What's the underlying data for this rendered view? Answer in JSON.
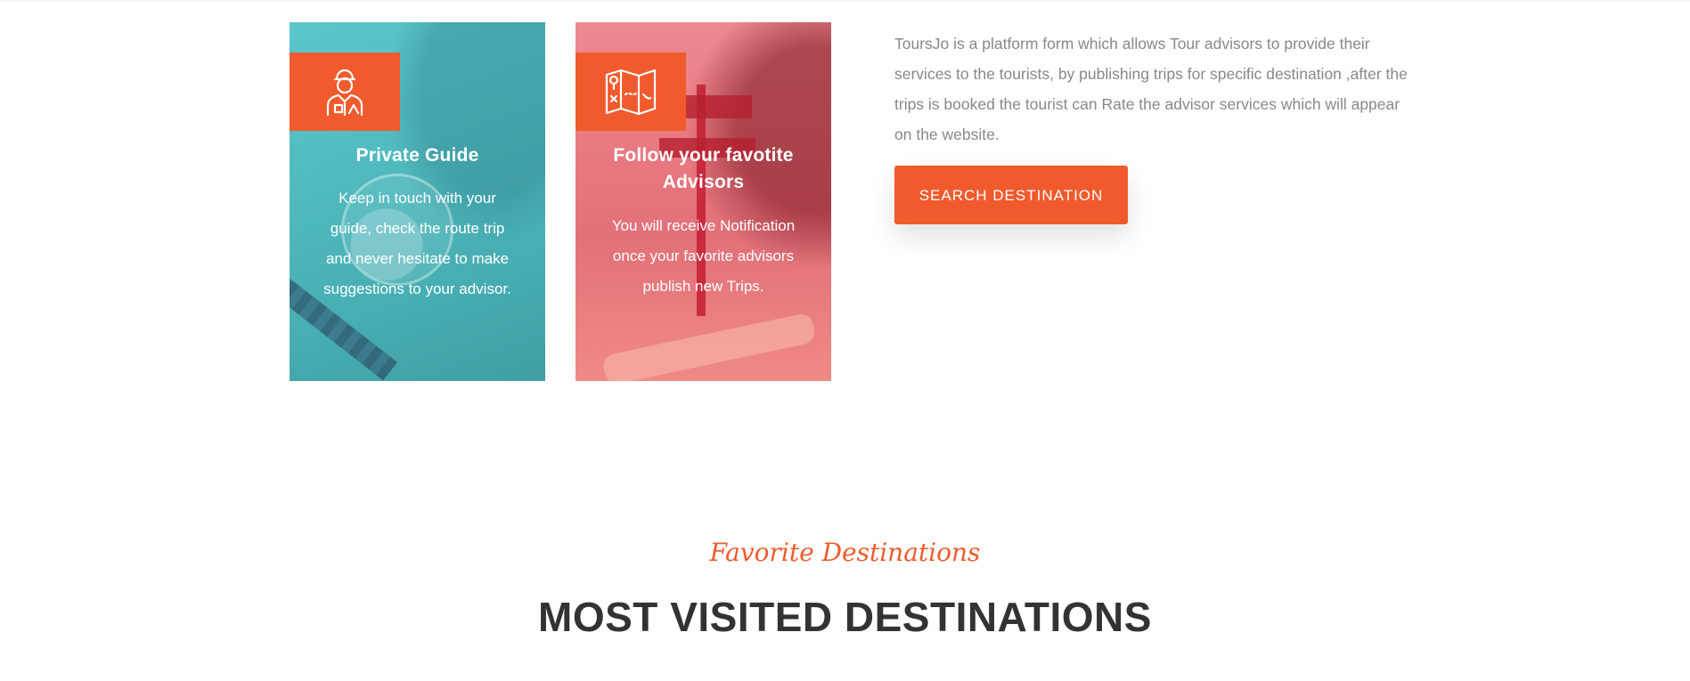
{
  "features": [
    {
      "icon": "tour-guide-icon",
      "title": "Private Guide",
      "description": "Keep in touch with your guide, check the route trip and never hesitate to make suggestions to your advisor.",
      "overlay_color": "#4fb8bd"
    },
    {
      "icon": "map-icon",
      "title": "Follow your favotite Advisors",
      "description": "You will receive Notification once your favorite advisors publish new Trips.",
      "overlay_color": "#e8777f"
    }
  ],
  "about": {
    "text": "ToursJo is a platform form which allows Tour advisors to provide their services to the tourists, by publishing trips for specific destination ,after the trips is booked the tourist can Rate the advisor services which will appear on the website.",
    "button_label": "SEARCH DESTINATION"
  },
  "section": {
    "subtitle": "Favorite Destinations",
    "title": "MOST VISITED DESTINATIONS"
  },
  "colors": {
    "accent": "#f15a2c",
    "heading": "#333333",
    "body_text": "#888888"
  }
}
